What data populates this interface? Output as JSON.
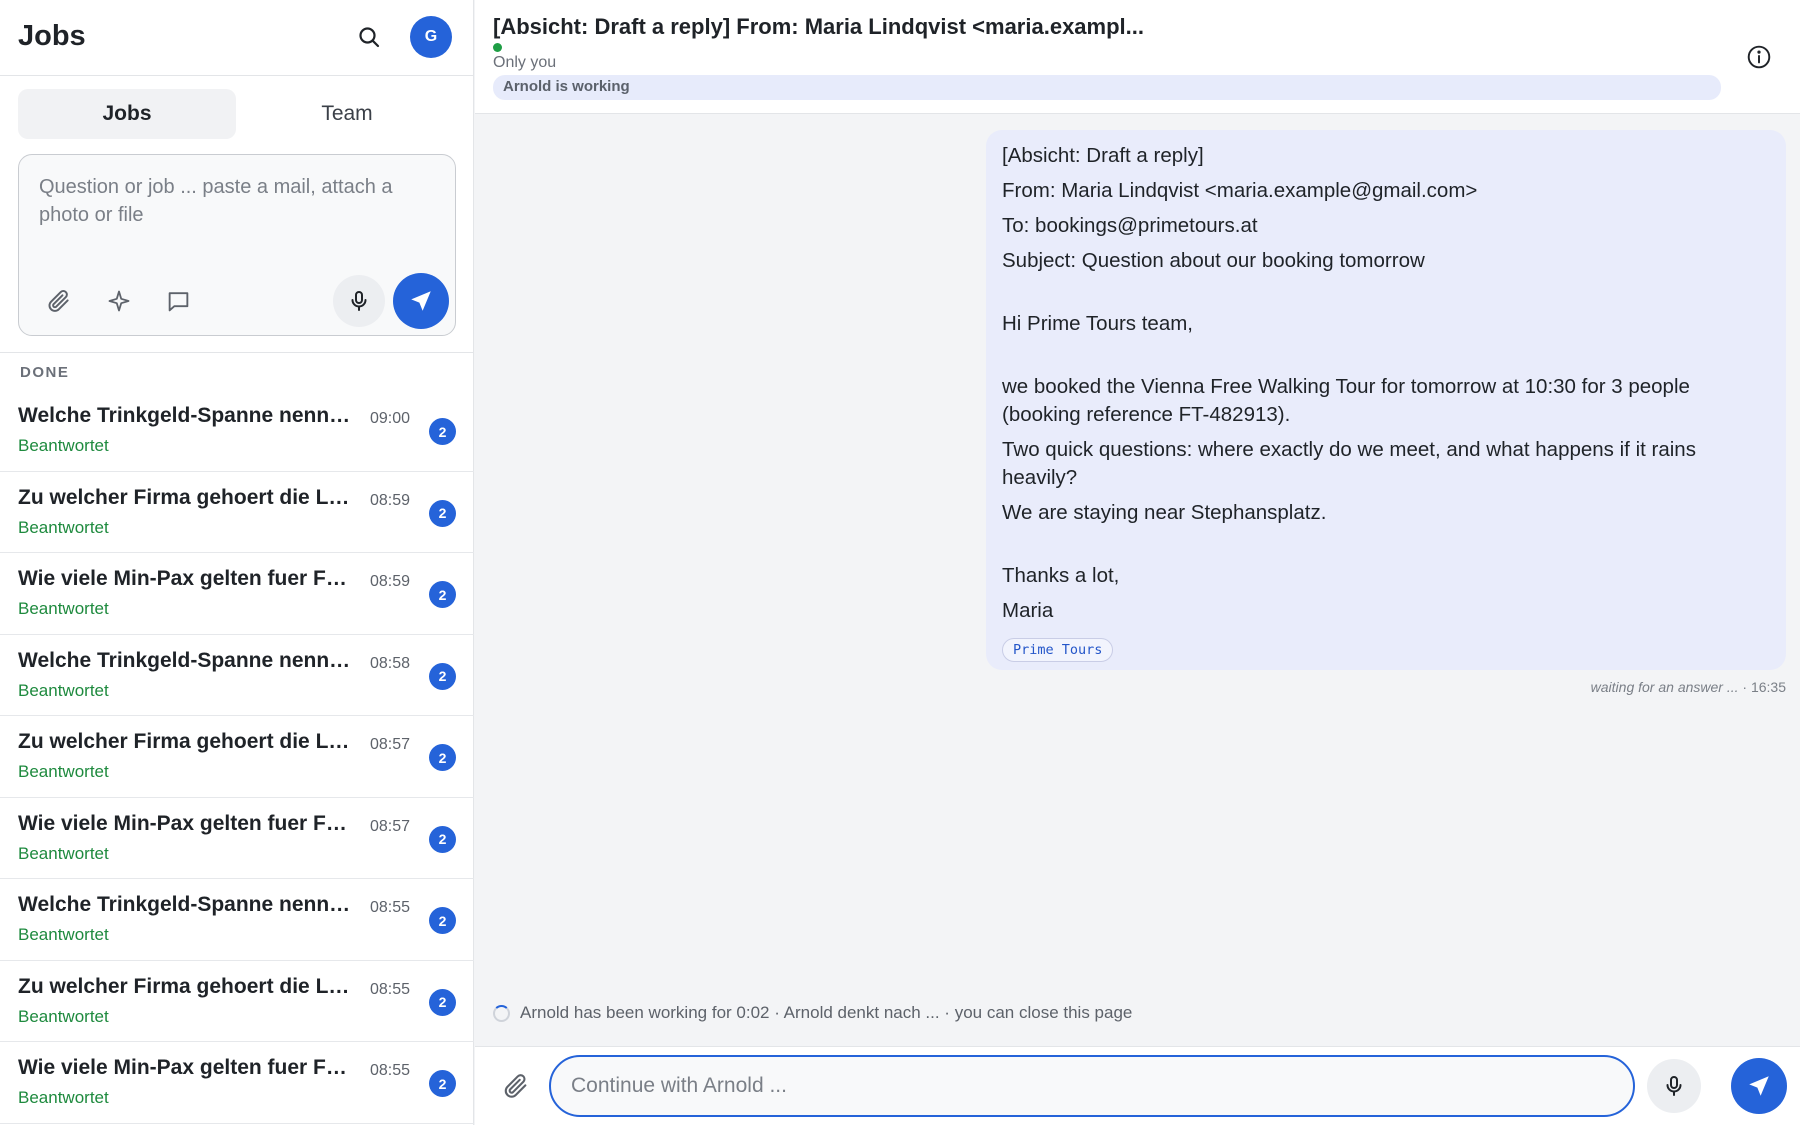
{
  "sidebar": {
    "title": "Jobs",
    "avatar_initial": "G",
    "tabs": [
      {
        "label": "Jobs",
        "active": true
      },
      {
        "label": "Team",
        "active": false
      }
    ],
    "composer": {
      "placeholder": "Question or job ... paste a mail, attach a photo or file"
    },
    "section_label": "DONE",
    "jobs": [
      {
        "title": "Welche Trinkgeld-Spanne nennt ...",
        "time": "09:00",
        "status": "Beantwortet",
        "badge": "2"
      },
      {
        "title": "Zu welcher Firma gehoert die Lea...",
        "time": "08:59",
        "status": "Beantwortet",
        "badge": "2"
      },
      {
        "title": "Wie viele Min-Pax gelten fuer Fre...",
        "time": "08:59",
        "status": "Beantwortet",
        "badge": "2"
      },
      {
        "title": "Welche Trinkgeld-Spanne nennt ...",
        "time": "08:58",
        "status": "Beantwortet",
        "badge": "2"
      },
      {
        "title": "Zu welcher Firma gehoert die Lea...",
        "time": "08:57",
        "status": "Beantwortet",
        "badge": "2"
      },
      {
        "title": "Wie viele Min-Pax gelten fuer Fre...",
        "time": "08:57",
        "status": "Beantwortet",
        "badge": "2"
      },
      {
        "title": "Welche Trinkgeld-Spanne nennt ...",
        "time": "08:55",
        "status": "Beantwortet",
        "badge": "2"
      },
      {
        "title": "Zu welcher Firma gehoert die Lea...",
        "time": "08:55",
        "status": "Beantwortet",
        "badge": "2"
      },
      {
        "title": "Wie viele Min-Pax gelten fuer Fre...",
        "time": "08:55",
        "status": "Beantwortet",
        "badge": "2"
      }
    ]
  },
  "main": {
    "header": {
      "title": "[Absicht: Draft a reply] From: Maria Lindqvist <maria.exampl...",
      "visibility": "Only you",
      "working": "Arnold is working"
    },
    "message": {
      "lines": [
        "[Absicht: Draft a reply]",
        "From: Maria Lindqvist <maria.example@gmail.com>",
        "To: bookings@primetours.at",
        "Subject: Question about our booking tomorrow",
        "",
        "Hi Prime Tours team,",
        "",
        "we booked the Vienna Free Walking Tour for tomorrow at 10:30 for 3 people (booking reference FT-482913).",
        "Two quick questions: where exactly do we meet, and what happens if it rains heavily?",
        "We are staying near Stephansplatz.",
        "",
        "Thanks a lot,",
        "Maria"
      ],
      "tag": "Prime Tours",
      "meta_status": "waiting for an answer ...",
      "meta_time": "· 16:35"
    },
    "progress": "Arnold has been working for 0:02 · Arnold denkt nach ... · you can close this page",
    "footer": {
      "placeholder": "Continue with Arnold ..."
    }
  },
  "colors": {
    "accent": "#2563d9",
    "status_green": "#1e8a3e",
    "bubble_bg": "#e9ecfb"
  }
}
